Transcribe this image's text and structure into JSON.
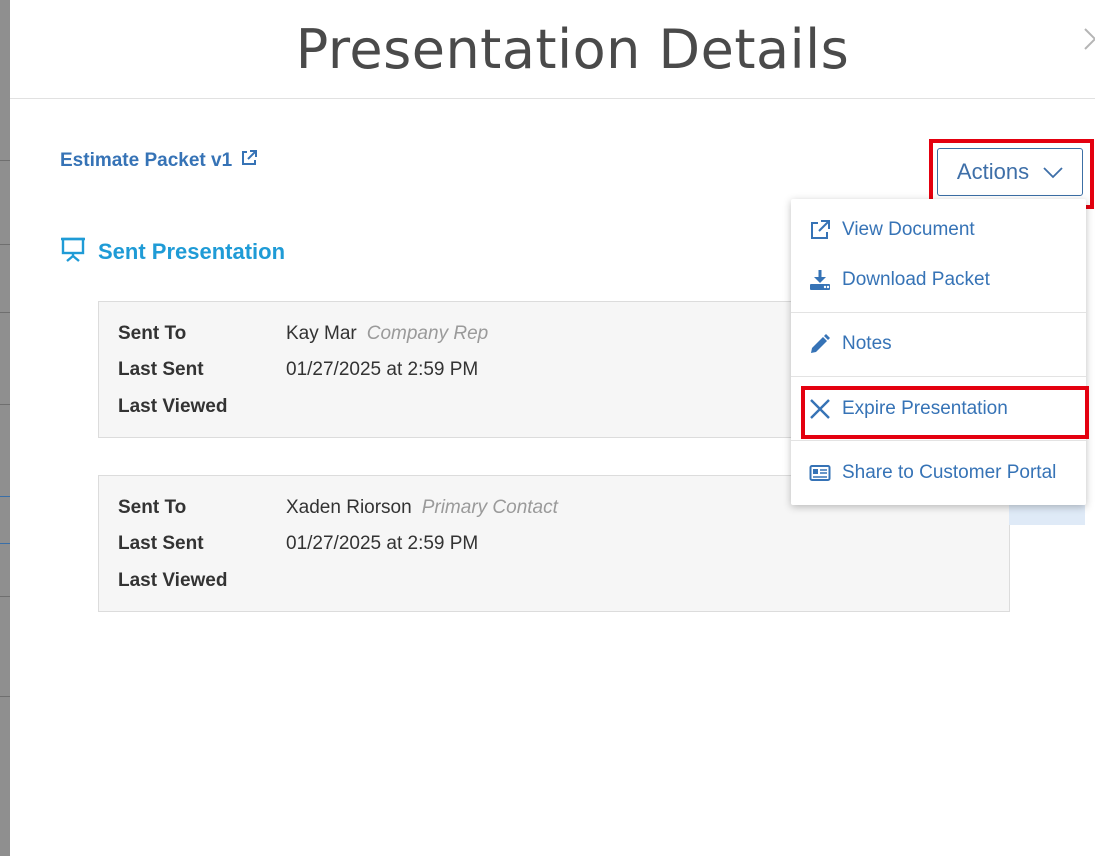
{
  "modal": {
    "title": "Presentation Details"
  },
  "packet": {
    "link_label": "Estimate Packet v1"
  },
  "section": {
    "heading": "Sent Presentation"
  },
  "cards": [
    {
      "sent_to_label": "Sent To",
      "sent_to_name": "Kay Mar",
      "sent_to_role": "Company Rep",
      "last_sent_label": "Last Sent",
      "last_sent_value": "01/27/2025 at 2:59 PM",
      "last_viewed_label": "Last Viewed",
      "last_viewed_value": ""
    },
    {
      "sent_to_label": "Sent To",
      "sent_to_name": "Xaden Riorson",
      "sent_to_role": "Primary Contact",
      "last_sent_label": "Last Sent",
      "last_sent_value": "01/27/2025 at 2:59 PM",
      "last_viewed_label": "Last Viewed",
      "last_viewed_value": ""
    }
  ],
  "actions": {
    "label": "Actions",
    "menu": [
      {
        "label": "View Document",
        "icon": "external-link-icon"
      },
      {
        "label": "Download Packet",
        "icon": "download-icon"
      },
      {
        "label": "Notes",
        "icon": "pencil-icon"
      },
      {
        "label": "Expire Presentation",
        "icon": "x-icon"
      },
      {
        "label": "Share to Customer Portal",
        "icon": "id-card-icon"
      }
    ]
  },
  "colors": {
    "link_blue": "#3673b6",
    "heading_blue": "#1f9bd6",
    "highlight_red": "#e4000f"
  }
}
